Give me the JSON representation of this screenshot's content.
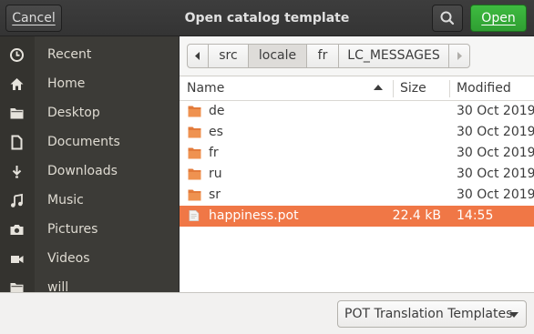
{
  "header": {
    "cancel_label": "Cancel",
    "title": "Open catalog template",
    "open_label": "Open"
  },
  "sidebar": {
    "items": [
      {
        "label": "Recent",
        "icon": "clock-icon"
      },
      {
        "label": "Home",
        "icon": "home-icon"
      },
      {
        "label": "Desktop",
        "icon": "folder-icon"
      },
      {
        "label": "Documents",
        "icon": "document-icon"
      },
      {
        "label": "Downloads",
        "icon": "download-icon"
      },
      {
        "label": "Music",
        "icon": "music-icon"
      },
      {
        "label": "Pictures",
        "icon": "camera-icon"
      },
      {
        "label": "Videos",
        "icon": "video-icon"
      },
      {
        "label": "will",
        "icon": "folder-icon"
      }
    ]
  },
  "pathbar": {
    "segments": [
      "src",
      "locale",
      "fr",
      "LC_MESSAGES"
    ],
    "active_segment": "locale"
  },
  "columns": {
    "name": "Name",
    "size": "Size",
    "modified": "Modified"
  },
  "files": [
    {
      "name": "de",
      "size": "",
      "modified": "30 Oct 2019",
      "type": "folder"
    },
    {
      "name": "es",
      "size": "",
      "modified": "30 Oct 2019",
      "type": "folder"
    },
    {
      "name": "fr",
      "size": "",
      "modified": "30 Oct 2019",
      "type": "folder"
    },
    {
      "name": "ru",
      "size": "",
      "modified": "30 Oct 2019",
      "type": "folder"
    },
    {
      "name": "sr",
      "size": "",
      "modified": "30 Oct 2019",
      "type": "folder"
    },
    {
      "name": "happiness.pot",
      "size": "22.4 kB",
      "modified": "14:55",
      "type": "file",
      "selected": true
    }
  ],
  "footer": {
    "filter_label": "POT Translation Templates"
  },
  "colors": {
    "accent_selection": "#f07746",
    "open_button": "#38b13a",
    "folder": "#e37b3b"
  }
}
